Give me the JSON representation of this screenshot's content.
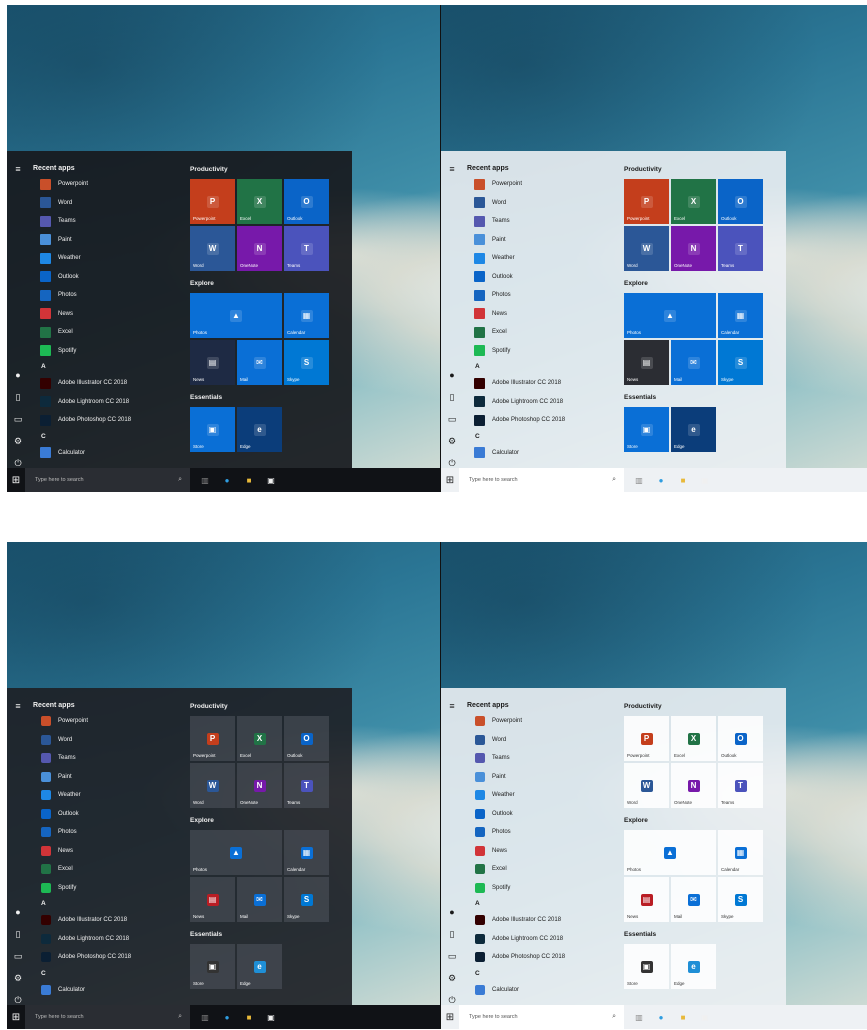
{
  "menu": {
    "recent_header": "Recent apps",
    "recent_apps": [
      {
        "label": "Powerpoint",
        "icon": "powerpoint-icon",
        "color": "#c94f2a"
      },
      {
        "label": "Word",
        "icon": "word-icon",
        "color": "#2b5797"
      },
      {
        "label": "Teams",
        "icon": "teams-icon",
        "color": "#5558af"
      },
      {
        "label": "Paint",
        "icon": "paint-icon",
        "color": "#4a90d9"
      },
      {
        "label": "Weather",
        "icon": "weather-icon",
        "color": "#1e88e5"
      },
      {
        "label": "Outlook",
        "icon": "outlook-icon",
        "color": "#0a64c8"
      },
      {
        "label": "Photos",
        "icon": "photos-icon",
        "color": "#1565c0"
      },
      {
        "label": "News",
        "icon": "news-icon",
        "color": "#d13438"
      },
      {
        "label": "Excel",
        "icon": "excel-icon",
        "color": "#217346"
      },
      {
        "label": "Spotify",
        "icon": "spotify-icon",
        "color": "#1db954"
      }
    ],
    "letter_a": "A",
    "a_apps": [
      {
        "label": "Adobe Illustrator CC 2018",
        "icon": "illustrator-icon",
        "color": "#330000"
      },
      {
        "label": "Adobe Lightroom CC 2018",
        "icon": "lightroom-icon",
        "color": "#0d2a3c"
      },
      {
        "label": "Adobe Photoshop CC 2018",
        "icon": "photoshop-icon",
        "color": "#0b1f33"
      }
    ],
    "letter_c": "C",
    "c_apps": [
      {
        "label": "Calculator",
        "icon": "calculator-icon",
        "color": "#3a7bd5"
      }
    ],
    "groups": {
      "productivity": "Productivity",
      "explore": "Explore",
      "essentials": "Essentials"
    },
    "productivity_tiles": [
      "Powerpoint",
      "Excel",
      "Outlook",
      "Word",
      "OneNote",
      "Teams"
    ],
    "explore_tiles": [
      "Photos",
      "Calendar",
      "News",
      "Mail",
      "Skype"
    ],
    "essentials_tiles": [
      "Store",
      "Edge"
    ]
  },
  "taskbar": {
    "search_placeholder": "Type here to search"
  },
  "colors": {
    "powerpoint": "#c43e1c",
    "excel": "#217346",
    "outlook": "#0a64c8",
    "word": "#2b5797",
    "onenote": "#7719aa",
    "teams": "#4b53bc",
    "accent_blue": "#0a6fd6",
    "skype": "#0078d4"
  }
}
